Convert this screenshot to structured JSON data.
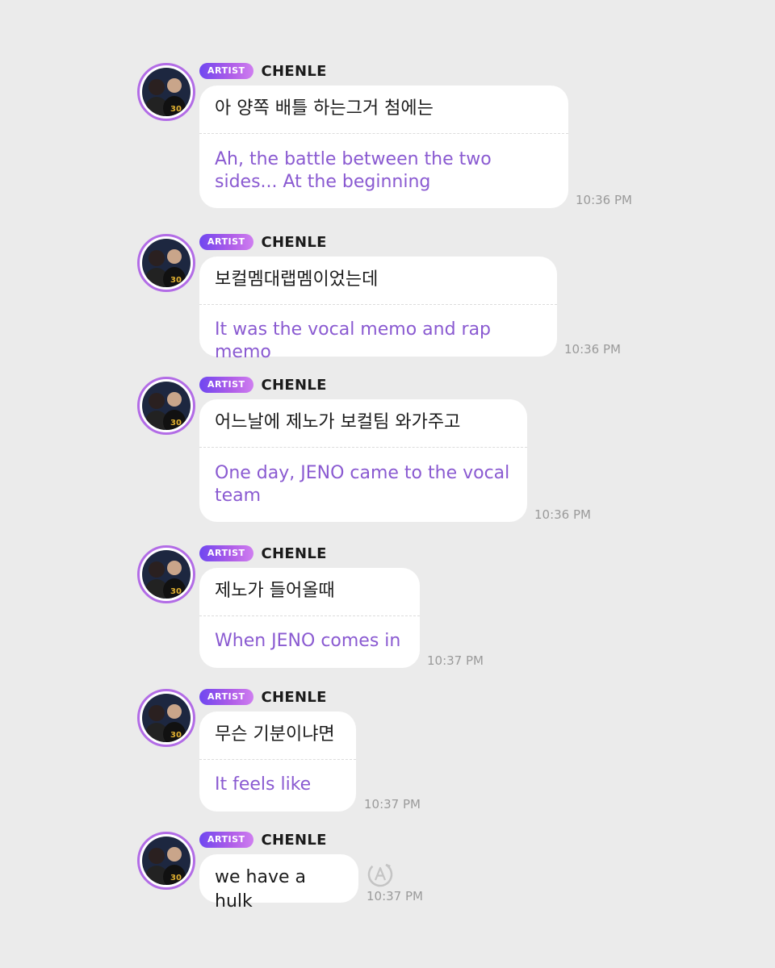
{
  "messages": [
    {
      "badge": "ARTIST",
      "name": "CHENLE",
      "korean": "아 양쪽 배틀 하는그거 첨에는",
      "english": "Ah, the battle between the two sides... At the beginning",
      "time": "10:36 PM"
    },
    {
      "badge": "ARTIST",
      "name": "CHENLE",
      "korean": "보컬멤대랩멤이었는데",
      "english": "It was the vocal memo and rap memo",
      "time": "10:36 PM"
    },
    {
      "badge": "ARTIST",
      "name": "CHENLE",
      "korean": "어느날에 제노가 보컬팀 와가주고",
      "english": "One day, JENO came to the vocal team",
      "time": "10:36 PM"
    },
    {
      "badge": "ARTIST",
      "name": "CHENLE",
      "korean": "제노가 들어올때",
      "english": "When JENO comes in",
      "time": "10:37 PM"
    },
    {
      "badge": "ARTIST",
      "name": "CHENLE",
      "korean": "무슨 기분이냐면",
      "english": "It feels like",
      "time": "10:37 PM"
    },
    {
      "badge": "ARTIST",
      "name": "CHENLE",
      "text": "we have a hulk",
      "time": "10:37 PM",
      "icon": "translate-icon"
    }
  ],
  "colors": {
    "background": "#ebebeb",
    "translation": "#8a5ad1",
    "badge_start": "#6f47f0",
    "badge_end": "#cf7ef0"
  }
}
